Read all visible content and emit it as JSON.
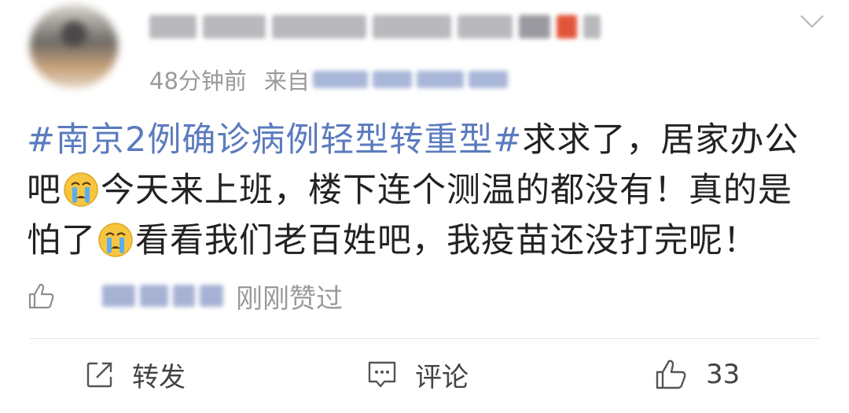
{
  "header": {
    "timestamp": "48分钟前",
    "source_label": "来自"
  },
  "post": {
    "hashtag": "#南京2例确诊病例轻型转重型#",
    "text_part1": "求求了，居家办公吧",
    "text_part2": "今天来上班，楼下连个测温的都没有！真的是怕了",
    "text_part3": "看看我们老百姓吧，我疫苗还没打完呢！",
    "emoji": "crying-face-emoji"
  },
  "liked": {
    "text": "刚刚赞过"
  },
  "actions": {
    "repost_label": "转发",
    "comment_label": "评论",
    "like_count": "33"
  },
  "colors": {
    "hashtag": "#5b7bbe",
    "meta_text": "#9a9a9a",
    "body_text": "#222222"
  }
}
